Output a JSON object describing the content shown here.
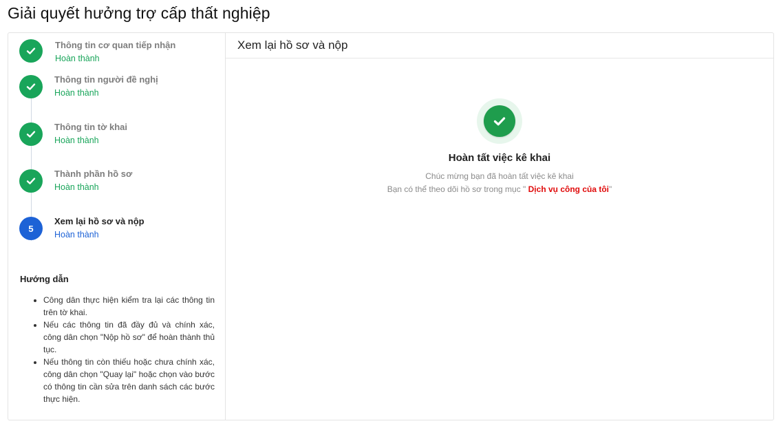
{
  "page": {
    "title": "Giải quyết hưởng trợ cấp thất nghiệp"
  },
  "steps": [
    {
      "title": "Thông tin cơ quan tiếp nhận",
      "status": "Hoàn thành",
      "state": "done"
    },
    {
      "title": "Thông tin người đề nghị",
      "status": "Hoàn thành",
      "state": "done"
    },
    {
      "title": "Thông tin tờ khai",
      "status": "Hoàn thành",
      "state": "done"
    },
    {
      "title": "Thành phần hồ sơ",
      "status": "Hoàn thành",
      "state": "done"
    },
    {
      "number": "5",
      "title": "Xem lại hồ sơ và nộp",
      "status": "Hoàn thành",
      "state": "active"
    }
  ],
  "guide": {
    "title": "Hướng dẫn",
    "items": [
      "Công dân thực hiện kiểm tra lại các thông tin trên tờ khai.",
      "Nếu các thông tin đã đầy đủ và chính xác, công dân chọn \"Nộp hồ sơ\" để hoàn thành thủ tục.",
      "Nếu thông tin còn thiếu hoặc chưa chính xác, công dân chọn \"Quay lại\" hoặc chọn vào bước có thông tin cần sửa trên danh sách các bước thực hiện."
    ]
  },
  "main": {
    "header": "Xem lại hồ sơ và nộp",
    "success_title": "Hoàn tất việc kê khai",
    "line1": "Chúc mừng bạn đã hoàn tất việc kê khai",
    "line2_prefix": "Bạn có thể theo dõi hồ sơ trong mục \" ",
    "line2_link": "Dịch vụ công của tôi",
    "line2_suffix": "\""
  },
  "colors": {
    "done": "#19a55a",
    "active": "#1d62d6",
    "link": "#e00a0a"
  },
  "icons": {
    "step_done": "check-icon",
    "success": "check-circle-icon"
  }
}
